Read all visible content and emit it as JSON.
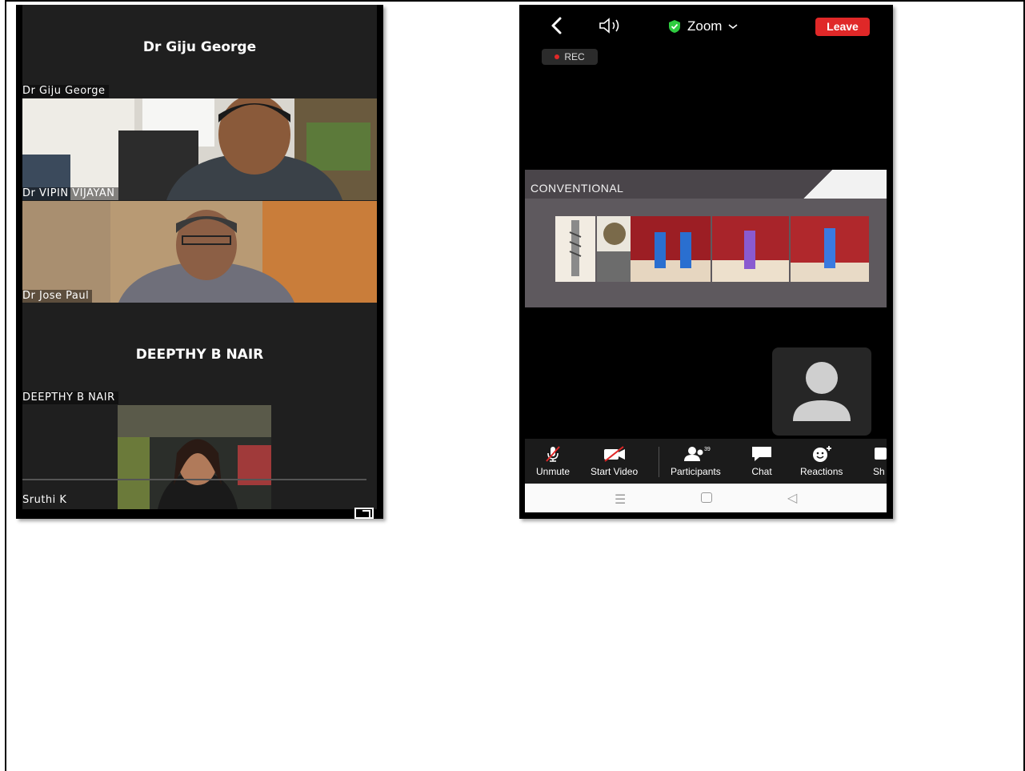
{
  "gallery": {
    "banner_1": "Dr Giju George",
    "label_1": "Dr Giju George",
    "label_2": "Dr VIPIN VIJAYAN",
    "label_3": "Dr Jose Paul",
    "banner_2": "DEEPTHY B NAIR",
    "label_4": "DEEPTHY B NAIR",
    "label_5": "Sruthi K"
  },
  "meeting": {
    "title": "Zoom",
    "leave_label": "Leave",
    "rec_label": "REC",
    "shared_slide_title": "CONVENTIONAL",
    "participant_count": "39"
  },
  "toolbar": {
    "items": [
      {
        "label": "Unmute",
        "icon": "microphone-muted-icon"
      },
      {
        "label": "Start Video",
        "icon": "camera-off-icon"
      },
      {
        "label": "Participants",
        "icon": "participants-icon"
      },
      {
        "label": "Chat",
        "icon": "chat-bubble-icon"
      },
      {
        "label": "Reactions",
        "icon": "smiley-plus-icon"
      },
      {
        "label": "Sh",
        "icon": "share-icon"
      }
    ]
  },
  "android_nav": [
    "menu-icon",
    "home-square-icon",
    "back-triangle-icon"
  ],
  "colors": {
    "leave": "#e02828",
    "shield": "#2ecc40",
    "panel": "#1f1f1f",
    "slide": "#5e595e"
  }
}
